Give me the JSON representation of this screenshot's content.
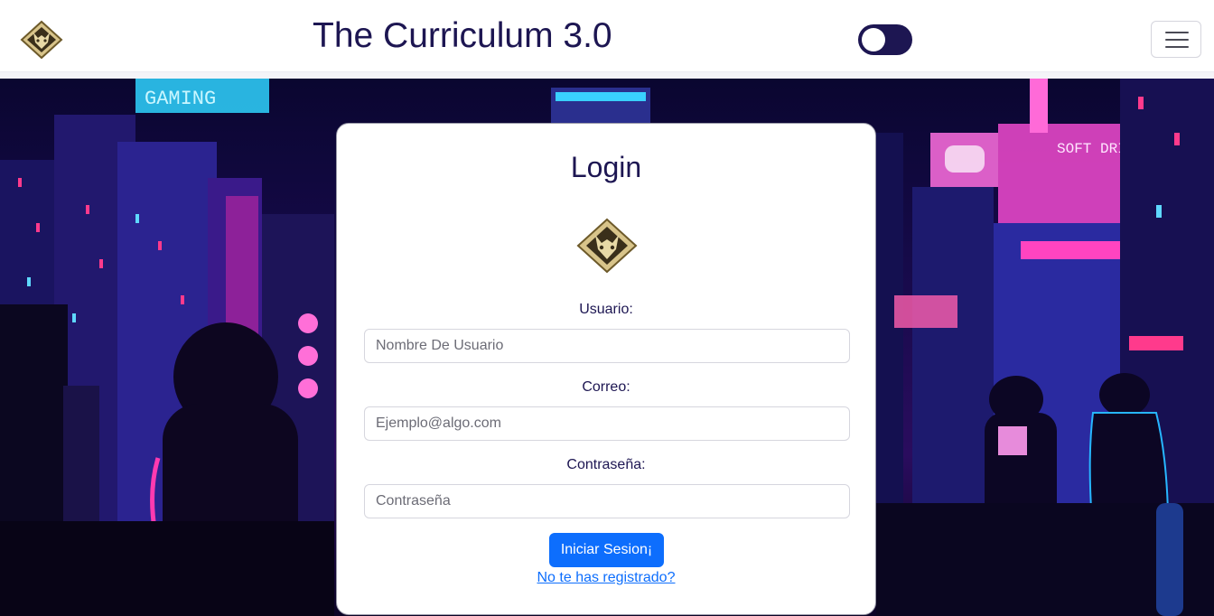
{
  "navbar": {
    "title": "The Curriculum 3.0",
    "logo_icon": "wolf-emblem-icon",
    "theme_toggle": {
      "state": "off",
      "color": "#1d1652"
    },
    "menu_icon": "hamburger-icon"
  },
  "hero": {
    "sign_top_left": "GAMING",
    "sign_right": "SOFT DRINK"
  },
  "login": {
    "title": "Login",
    "logo_icon": "wolf-emblem-icon",
    "username": {
      "label": "Usuario:",
      "placeholder": "Nombre De Usuario",
      "value": ""
    },
    "email": {
      "label": "Correo:",
      "placeholder": "Ejemplo@algo.com",
      "value": ""
    },
    "password": {
      "label": "Contraseña:",
      "placeholder": "Contraseña",
      "value": ""
    },
    "submit_label": "Iniciar Sesion¡",
    "register_link": "No te has registrado?"
  },
  "colors": {
    "primary_text": "#1d1652",
    "button": "#0d6efd",
    "link": "#0d6efd"
  }
}
